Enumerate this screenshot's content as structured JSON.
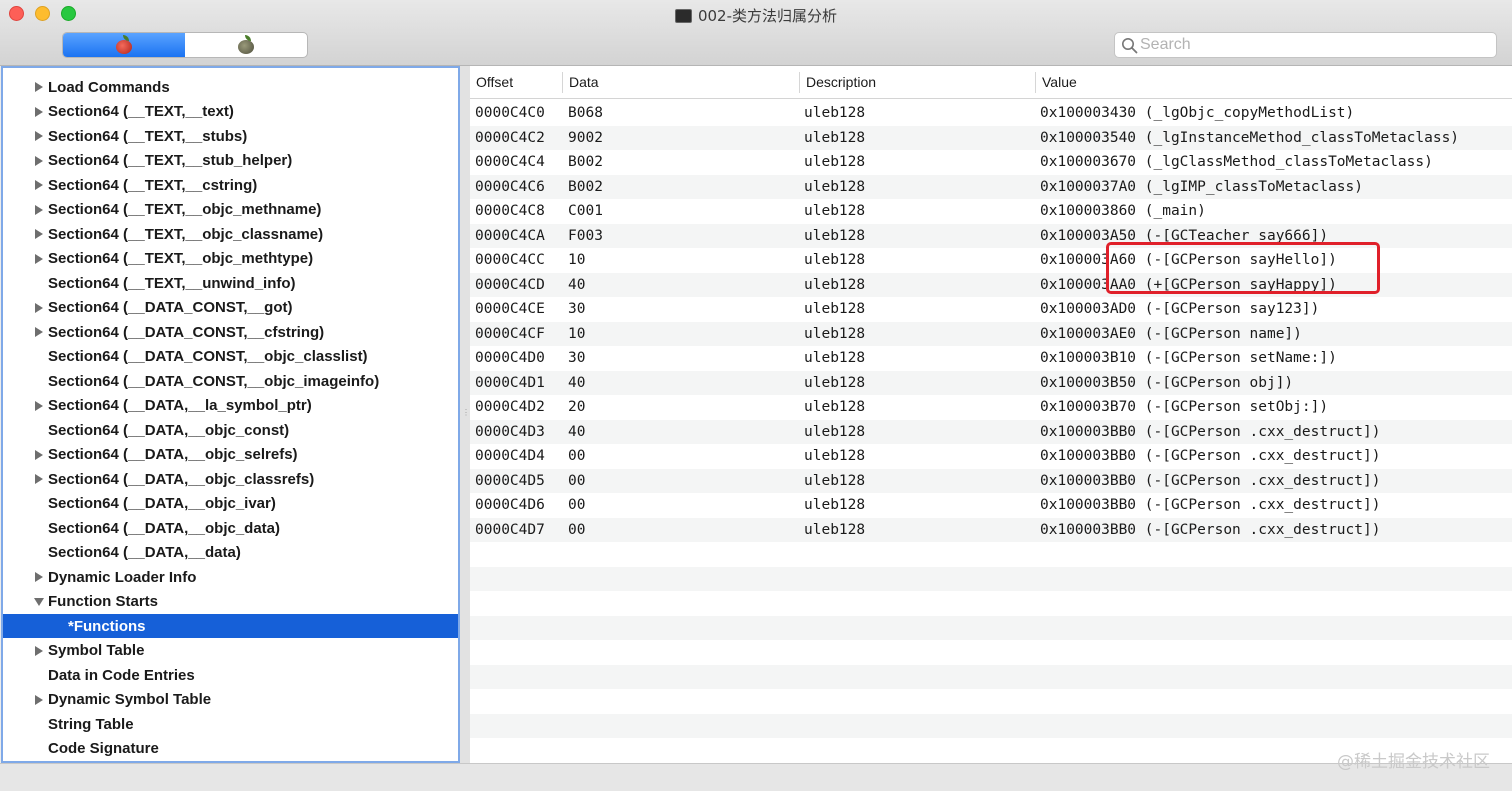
{
  "window": {
    "title": "002-类方法归属分析"
  },
  "search": {
    "placeholder": "Search"
  },
  "sidebar": {
    "items": [
      {
        "label": "Load Commands",
        "expander": "right",
        "indent": 0
      },
      {
        "label": "Section64 (__TEXT,__text)",
        "expander": "right",
        "indent": 0
      },
      {
        "label": "Section64 (__TEXT,__stubs)",
        "expander": "right",
        "indent": 0
      },
      {
        "label": "Section64 (__TEXT,__stub_helper)",
        "expander": "right",
        "indent": 0
      },
      {
        "label": "Section64 (__TEXT,__cstring)",
        "expander": "right",
        "indent": 0
      },
      {
        "label": "Section64 (__TEXT,__objc_methname)",
        "expander": "right",
        "indent": 0
      },
      {
        "label": "Section64 (__TEXT,__objc_classname)",
        "expander": "right",
        "indent": 0
      },
      {
        "label": "Section64 (__TEXT,__objc_methtype)",
        "expander": "right",
        "indent": 0
      },
      {
        "label": "Section64 (__TEXT,__unwind_info)",
        "expander": "none",
        "indent": 0
      },
      {
        "label": "Section64 (__DATA_CONST,__got)",
        "expander": "right",
        "indent": 0
      },
      {
        "label": "Section64 (__DATA_CONST,__cfstring)",
        "expander": "right",
        "indent": 0
      },
      {
        "label": "Section64 (__DATA_CONST,__objc_classlist)",
        "expander": "none",
        "indent": 0
      },
      {
        "label": "Section64 (__DATA_CONST,__objc_imageinfo)",
        "expander": "none",
        "indent": 0
      },
      {
        "label": "Section64 (__DATA,__la_symbol_ptr)",
        "expander": "right",
        "indent": 0
      },
      {
        "label": "Section64 (__DATA,__objc_const)",
        "expander": "none",
        "indent": 0
      },
      {
        "label": "Section64 (__DATA,__objc_selrefs)",
        "expander": "right",
        "indent": 0
      },
      {
        "label": "Section64 (__DATA,__objc_classrefs)",
        "expander": "right",
        "indent": 0
      },
      {
        "label": "Section64 (__DATA,__objc_ivar)",
        "expander": "none",
        "indent": 0
      },
      {
        "label": "Section64 (__DATA,__objc_data)",
        "expander": "none",
        "indent": 0
      },
      {
        "label": "Section64 (__DATA,__data)",
        "expander": "none",
        "indent": 0
      },
      {
        "label": "Dynamic Loader Info",
        "expander": "right",
        "indent": 0
      },
      {
        "label": "Function Starts",
        "expander": "down",
        "indent": 0
      },
      {
        "label": "*Functions",
        "expander": "none",
        "indent": 1,
        "selected": true
      },
      {
        "label": "Symbol Table",
        "expander": "right",
        "indent": 0
      },
      {
        "label": "Data in Code Entries",
        "expander": "none",
        "indent": 0
      },
      {
        "label": "Dynamic Symbol Table",
        "expander": "right",
        "indent": 0
      },
      {
        "label": "String Table",
        "expander": "none",
        "indent": 0
      },
      {
        "label": "Code Signature",
        "expander": "none",
        "indent": 0
      }
    ]
  },
  "table": {
    "columns": [
      "Offset",
      "Data",
      "Description",
      "Value"
    ],
    "rows": [
      [
        "0000C4C0",
        "B068",
        "uleb128",
        "0x100003430 (_lgObjc_copyMethodList)"
      ],
      [
        "0000C4C2",
        "9002",
        "uleb128",
        "0x100003540 (_lgInstanceMethod_classToMetaclass)"
      ],
      [
        "0000C4C4",
        "B002",
        "uleb128",
        "0x100003670 (_lgClassMethod_classToMetaclass)"
      ],
      [
        "0000C4C6",
        "B002",
        "uleb128",
        "0x1000037A0 (_lgIMP_classToMetaclass)"
      ],
      [
        "0000C4C8",
        "C001",
        "uleb128",
        "0x100003860 (_main)"
      ],
      [
        "0000C4CA",
        "F003",
        "uleb128",
        "0x100003A50 (-[GCTeacher say666])"
      ],
      [
        "0000C4CC",
        "10",
        "uleb128",
        "0x100003A60 (-[GCPerson sayHello])"
      ],
      [
        "0000C4CD",
        "40",
        "uleb128",
        "0x100003AA0 (+[GCPerson sayHappy])"
      ],
      [
        "0000C4CE",
        "30",
        "uleb128",
        "0x100003AD0 (-[GCPerson say123])"
      ],
      [
        "0000C4CF",
        "10",
        "uleb128",
        "0x100003AE0 (-[GCPerson name])"
      ],
      [
        "0000C4D0",
        "30",
        "uleb128",
        "0x100003B10 (-[GCPerson setName:])"
      ],
      [
        "0000C4D1",
        "40",
        "uleb128",
        "0x100003B50 (-[GCPerson obj])"
      ],
      [
        "0000C4D2",
        "20",
        "uleb128",
        "0x100003B70 (-[GCPerson setObj:])"
      ],
      [
        "0000C4D3",
        "40",
        "uleb128",
        "0x100003BB0 (-[GCPerson .cxx_destruct])"
      ],
      [
        "0000C4D4",
        "00",
        "uleb128",
        "0x100003BB0 (-[GCPerson .cxx_destruct])"
      ],
      [
        "0000C4D5",
        "00",
        "uleb128",
        "0x100003BB0 (-[GCPerson .cxx_destruct])"
      ],
      [
        "0000C4D6",
        "00",
        "uleb128",
        "0x100003BB0 (-[GCPerson .cxx_destruct])"
      ],
      [
        "0000C4D7",
        "00",
        "uleb128",
        "0x100003BB0 (-[GCPerson .cxx_destruct])"
      ]
    ],
    "empty_rows": 9
  },
  "toolbar": {
    "left_icon": "red-apple-icon",
    "right_icon": "gray-apple-icon"
  },
  "watermark": "@稀土掘金技术社区",
  "colors": {
    "selection": "#1660d8",
    "highlight_box": "#e0202a",
    "sidebar_border": "#7fa9e8"
  }
}
